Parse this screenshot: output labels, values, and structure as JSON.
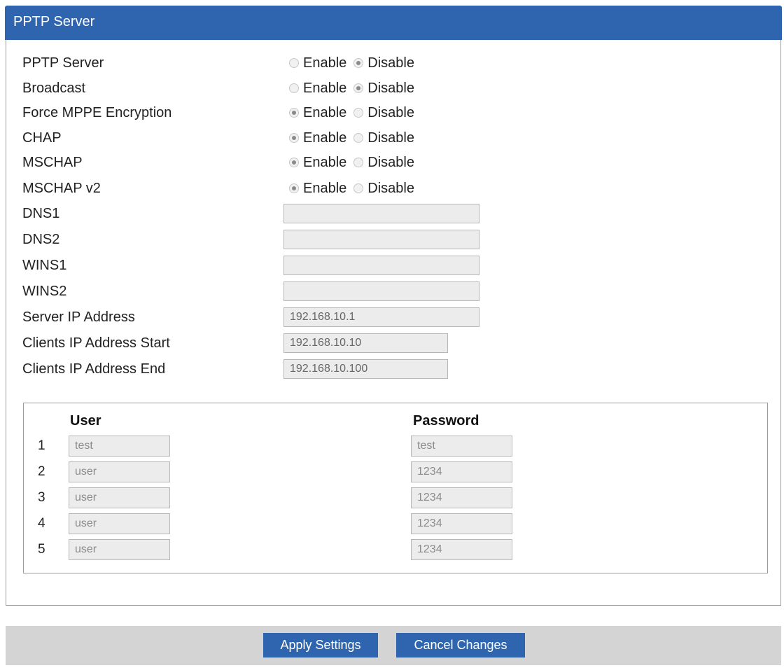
{
  "panel": {
    "title": "PPTP Server"
  },
  "options": [
    {
      "label": "PPTP Server",
      "enable_label": "Enable",
      "disable_label": "Disable",
      "selected": "Disable"
    },
    {
      "label": "Broadcast",
      "enable_label": "Enable",
      "disable_label": "Disable",
      "selected": "Disable"
    },
    {
      "label": "Force MPPE Encryption",
      "enable_label": "Enable",
      "disable_label": "Disable",
      "selected": "Enable"
    },
    {
      "label": "CHAP",
      "enable_label": "Enable",
      "disable_label": "Disable",
      "selected": "Enable"
    },
    {
      "label": "MSCHAP",
      "enable_label": "Enable",
      "disable_label": "Disable",
      "selected": "Enable"
    },
    {
      "label": "MSCHAP v2",
      "enable_label": "Enable",
      "disable_label": "Disable",
      "selected": "Enable"
    }
  ],
  "fields": [
    {
      "label": "DNS1",
      "value": ""
    },
    {
      "label": "DNS2",
      "value": ""
    },
    {
      "label": "WINS1",
      "value": ""
    },
    {
      "label": "WINS2",
      "value": ""
    },
    {
      "label": "Server IP Address",
      "value": "192.168.10.1"
    },
    {
      "label": "Clients IP Address Start",
      "value": "192.168.10.10"
    },
    {
      "label": "Clients IP Address End",
      "value": "192.168.10.100"
    }
  ],
  "users": {
    "user_header": "User",
    "password_header": "Password",
    "rows": [
      {
        "num": "1",
        "user": "test",
        "password": "test"
      },
      {
        "num": "2",
        "user": "user",
        "password": "1234"
      },
      {
        "num": "3",
        "user": "user",
        "password": "1234"
      },
      {
        "num": "4",
        "user": "user",
        "password": "1234"
      },
      {
        "num": "5",
        "user": "user",
        "password": "1234"
      }
    ]
  },
  "footer": {
    "apply_label": "Apply Settings",
    "cancel_label": "Cancel Changes"
  }
}
